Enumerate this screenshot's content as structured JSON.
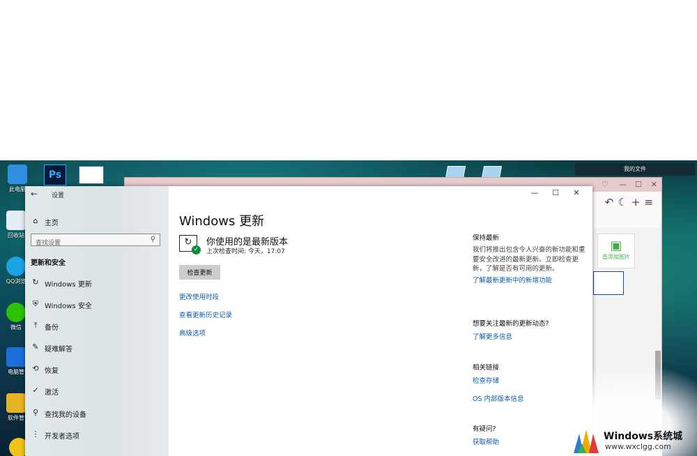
{
  "desktop": {
    "icons": [
      "此电脑",
      "回收站",
      "QQ浏览",
      "微信",
      "电脑管",
      "软件管"
    ],
    "panel_title": "我的文件"
  },
  "bg_window": {
    "add_image_label": "击添加图片"
  },
  "settings": {
    "app_title": "设置",
    "back_symbol": "←",
    "window_controls": [
      "—",
      "☐",
      "✕"
    ],
    "search_placeholder": "查找设置",
    "section_heading": "更新和安全",
    "nav": [
      {
        "label": "主页",
        "icon": "home-icon",
        "glyph": "⌂"
      },
      {
        "label": "Windows 更新",
        "icon": "refresh-icon",
        "glyph": "↻"
      },
      {
        "label": "Windows 安全",
        "icon": "shield-icon",
        "glyph": "⛨"
      },
      {
        "label": "备份",
        "icon": "backup-arrow-icon",
        "glyph": "⤒"
      },
      {
        "label": "疑难解答",
        "icon": "wrench-icon",
        "glyph": "✎"
      },
      {
        "label": "恢复",
        "icon": "history-icon",
        "glyph": "⟲"
      },
      {
        "label": "激活",
        "icon": "check-circle-icon",
        "glyph": "✓"
      },
      {
        "label": "查找我的设备",
        "icon": "person-location-icon",
        "glyph": "⚲"
      },
      {
        "label": "开发者选项",
        "icon": "developer-icon",
        "glyph": "⋮"
      }
    ],
    "main": {
      "title": "Windows 更新",
      "status_title": "你使用的是最新版本",
      "last_checked": "上次检查时间: 今天，17:07",
      "check_button": "检查更新",
      "links": [
        "更改使用时段",
        "查看更新历史记录",
        "高级选项"
      ]
    },
    "right": {
      "stay_current_heading": "保持最新",
      "stay_current_text": "我们将推出包含令人兴奋的新功能和重要安全改进的最新更新。立即检查更新，了解是否有可用的更新。",
      "stay_current_link": "了解最新更新中的新增功能",
      "news_heading": "想要关注最新的更新动态?",
      "news_link": "了解更多信息",
      "related_heading": "相关链接",
      "related_links": [
        "检查存储",
        "OS 内部版本信息"
      ],
      "help_heading": "有疑问?",
      "help_link": "获取帮助"
    }
  },
  "watermark": {
    "title": "Windows系统城",
    "url": "www.wxclgg.com"
  },
  "colors": {
    "link": "#0a5ea8",
    "check_badge": "#0f8a3a"
  }
}
